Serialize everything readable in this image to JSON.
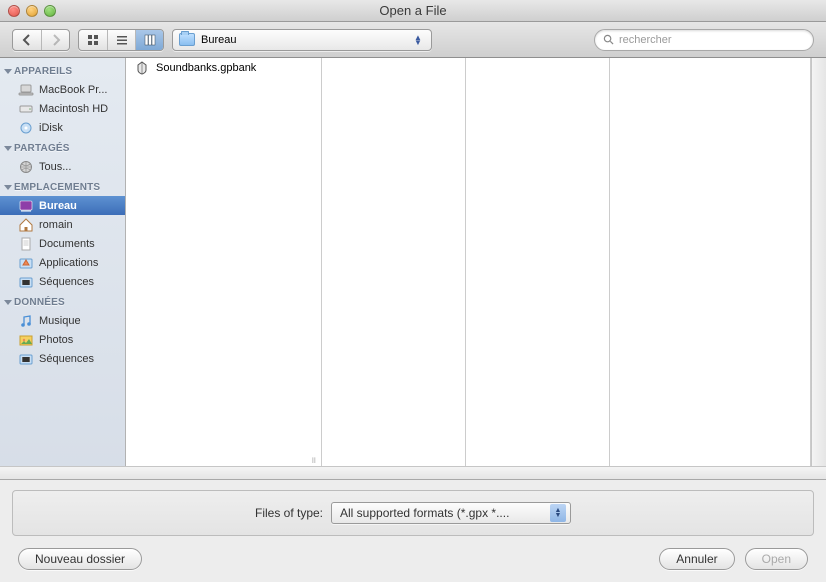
{
  "window": {
    "title": "Open a File"
  },
  "toolbar": {
    "location": "Bureau",
    "search_placeholder": "rechercher"
  },
  "sidebar": {
    "groups": [
      {
        "label": "APPAREILS",
        "items": [
          {
            "label": "MacBook Pr...",
            "icon": "laptop"
          },
          {
            "label": "Macintosh HD",
            "icon": "hdd"
          },
          {
            "label": "iDisk",
            "icon": "idisk"
          }
        ]
      },
      {
        "label": "PARTAGÉS",
        "items": [
          {
            "label": "Tous...",
            "icon": "globe"
          }
        ]
      },
      {
        "label": "EMPLACEMENTS",
        "items": [
          {
            "label": "Bureau",
            "icon": "desktop",
            "selected": true
          },
          {
            "label": "romain",
            "icon": "home"
          },
          {
            "label": "Documents",
            "icon": "docfolder"
          },
          {
            "label": "Applications",
            "icon": "appfolder"
          },
          {
            "label": "Séquences",
            "icon": "movies"
          }
        ]
      },
      {
        "label": "DONNÉES",
        "items": [
          {
            "label": "Musique",
            "icon": "music"
          },
          {
            "label": "Photos",
            "icon": "photos"
          },
          {
            "label": "Séquences",
            "icon": "movies"
          }
        ]
      }
    ]
  },
  "browser": {
    "files": [
      {
        "name": "Soundbanks.gpbank"
      }
    ]
  },
  "types": {
    "label": "Files of type:",
    "selected": "All supported formats (*.gpx *...."
  },
  "buttons": {
    "new_folder": "Nouveau dossier",
    "cancel": "Annuler",
    "open": "Open"
  }
}
